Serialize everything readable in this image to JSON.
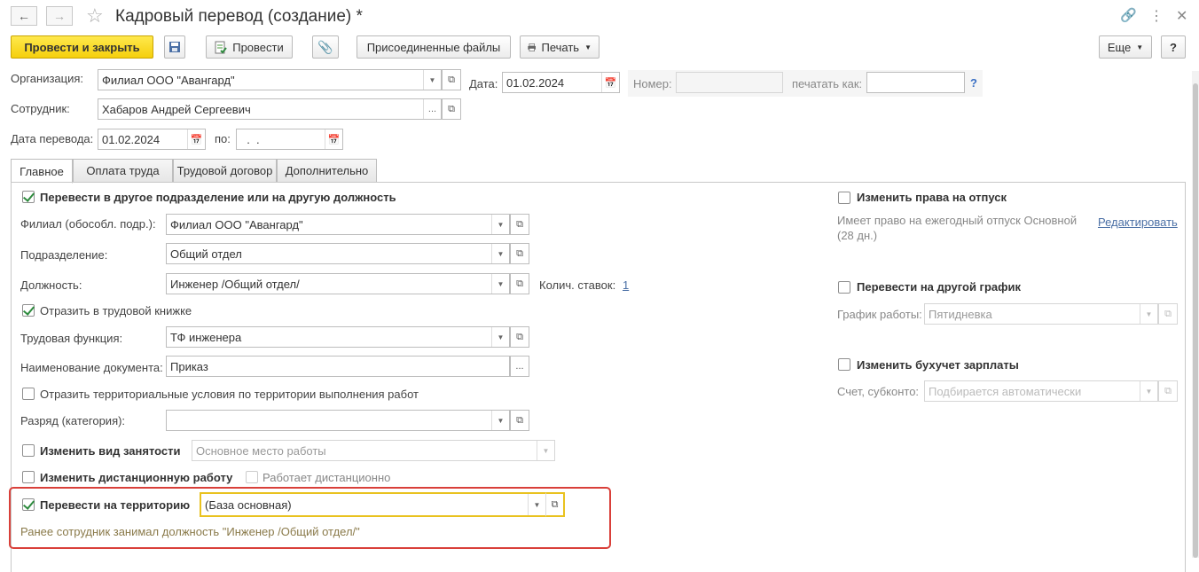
{
  "window": {
    "title": "Кадровый перевод (создание) *"
  },
  "toolbar": {
    "post_close": "Провести и закрыть",
    "post": "Провести",
    "attached": "Присоединенные файлы",
    "print": "Печать",
    "more": "Еще",
    "help": "?"
  },
  "header": {
    "org_label": "Организация:",
    "org_value": "Филиал ООО \"Авангард\"",
    "date_label": "Дата:",
    "date_value": "01.02.2024",
    "number_label": "Номер:",
    "number_value": "",
    "print_as_label": "печатать как:",
    "print_as_value": "",
    "help_q": "?",
    "employee_label": "Сотрудник:",
    "employee_value": "Хабаров Андрей Сергеевич",
    "transfer_date_label": "Дата перевода:",
    "transfer_date_value": "01.02.2024",
    "to_label": "по:",
    "to_value": "  .  ."
  },
  "tabs": [
    "Главное",
    "Оплата труда",
    "Трудовой договор",
    "Дополнительно"
  ],
  "main": {
    "transfer_dept": "Перевести в другое подразделение или на другую должность",
    "branch_label": "Филиал (обособл. подр.):",
    "branch_value": "Филиал ООО \"Авангард\"",
    "dept_label": "Подразделение:",
    "dept_value": "Общий отдел",
    "position_label": "Должность:",
    "position_value": "Инженер /Общий отдел/",
    "rates_label": "Колич. ставок:",
    "rates_value": "1",
    "workbook": "Отразить в трудовой книжке",
    "function_label": "Трудовая функция:",
    "function_value": "ТФ инженера",
    "docname_label": "Наименование документа:",
    "docname_value": "Приказ",
    "territorial": "Отразить территориальные условия по территории выполнения работ",
    "grade_label": "Разряд (категория):",
    "grade_value": "",
    "employment_label": "Изменить вид занятости",
    "employment_value": "Основное место работы",
    "remote_label": "Изменить дистанционную работу",
    "remote_works": "Работает дистанционно",
    "territory_label": "Перевести на территорию",
    "territory_value": "(База основная)",
    "previous_note": "Ранее сотрудник занимал должность \"Инженер /Общий отдел/\""
  },
  "right": {
    "vacation_label": "Изменить права на отпуск",
    "vacation_info": "Имеет право на ежегодный отпуск Основной",
    "vacation_info2": "(28 дн.)",
    "edit_link": "Редактировать",
    "schedule_label": "Перевести на другой график",
    "schedule_field_label": "График работы:",
    "schedule_value": "Пятидневка",
    "accounting_label": "Изменить бухучет зарплаты",
    "account_label": "Счет, субконто:",
    "account_value": "Подбирается автоматически"
  }
}
